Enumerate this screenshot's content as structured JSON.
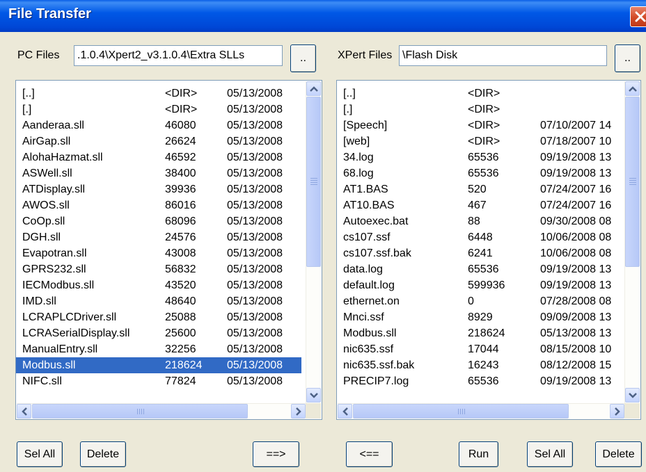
{
  "window": {
    "title": "File Transfer"
  },
  "pc": {
    "label": "PC Files",
    "path": ".1.0.4\\Xpert2_v3.1.0.4\\Extra SLLs",
    "browse_label": "..",
    "files": [
      {
        "name": "[..]",
        "size": "<DIR>",
        "date": "05/13/2008"
      },
      {
        "name": "[.]",
        "size": "<DIR>",
        "date": "05/13/2008"
      },
      {
        "name": "Aanderaa.sll",
        "size": "46080",
        "date": "05/13/2008"
      },
      {
        "name": "AirGap.sll",
        "size": "26624",
        "date": "05/13/2008"
      },
      {
        "name": "AlohaHazmat.sll",
        "size": "46592",
        "date": "05/13/2008"
      },
      {
        "name": "ASWell.sll",
        "size": "38400",
        "date": "05/13/2008"
      },
      {
        "name": "ATDisplay.sll",
        "size": "39936",
        "date": "05/13/2008"
      },
      {
        "name": "AWOS.sll",
        "size": "86016",
        "date": "05/13/2008"
      },
      {
        "name": "CoOp.sll",
        "size": "68096",
        "date": "05/13/2008"
      },
      {
        "name": "DGH.sll",
        "size": "24576",
        "date": "05/13/2008"
      },
      {
        "name": "Evapotran.sll",
        "size": "43008",
        "date": "05/13/2008"
      },
      {
        "name": "GPRS232.sll",
        "size": "56832",
        "date": "05/13/2008"
      },
      {
        "name": "IECModbus.sll",
        "size": "43520",
        "date": "05/13/2008"
      },
      {
        "name": "IMD.sll",
        "size": "48640",
        "date": "05/13/2008"
      },
      {
        "name": "LCRAPLCDriver.sll",
        "size": "25088",
        "date": "05/13/2008"
      },
      {
        "name": "LCRASerialDisplay.sll",
        "size": "25600",
        "date": "05/13/2008"
      },
      {
        "name": "ManualEntry.sll",
        "size": "32256",
        "date": "05/13/2008"
      },
      {
        "name": "Modbus.sll",
        "size": "218624",
        "date": "05/13/2008"
      },
      {
        "name": "NIFC.sll",
        "size": "77824",
        "date": "05/13/2008"
      }
    ],
    "selected_index": 17,
    "buttons": {
      "sel_all": "Sel All",
      "delete": "Delete",
      "to_xpert": "==>"
    }
  },
  "xpert": {
    "label": "XPert Files",
    "path": "\\Flash Disk",
    "browse_label": "..",
    "files": [
      {
        "name": "[..]",
        "size": "<DIR>",
        "date": ""
      },
      {
        "name": "[.]",
        "size": "<DIR>",
        "date": ""
      },
      {
        "name": "[Speech]",
        "size": "<DIR>",
        "date": "07/10/2007 14"
      },
      {
        "name": "[web]",
        "size": "<DIR>",
        "date": "07/18/2007 10"
      },
      {
        "name": "34.log",
        "size": "65536",
        "date": "09/19/2008 13"
      },
      {
        "name": "68.log",
        "size": "65536",
        "date": "09/19/2008 13"
      },
      {
        "name": "AT1.BAS",
        "size": "520",
        "date": "07/24/2007 16"
      },
      {
        "name": "AT10.BAS",
        "size": "467",
        "date": "07/24/2007 16"
      },
      {
        "name": "Autoexec.bat",
        "size": "88",
        "date": "09/30/2008 08"
      },
      {
        "name": "cs107.ssf",
        "size": "6448",
        "date": "10/06/2008 08"
      },
      {
        "name": "cs107.ssf.bak",
        "size": "6241",
        "date": "10/06/2008 08"
      },
      {
        "name": "data.log",
        "size": "65536",
        "date": "09/19/2008 13"
      },
      {
        "name": "default.log",
        "size": "599936",
        "date": "09/19/2008 13"
      },
      {
        "name": "ethernet.on",
        "size": "0",
        "date": "07/28/2008 08"
      },
      {
        "name": "Mnci.ssf",
        "size": "8929",
        "date": "09/09/2008 13"
      },
      {
        "name": "Modbus.sll",
        "size": "218624",
        "date": "05/13/2008 13"
      },
      {
        "name": "nic635.ssf",
        "size": "17044",
        "date": "08/15/2008 10"
      },
      {
        "name": "nic635.ssf.bak",
        "size": "16243",
        "date": "08/12/2008 15"
      },
      {
        "name": "PRECIP7.log",
        "size": "65536",
        "date": "09/19/2008 13"
      }
    ],
    "buttons": {
      "to_pc": "<==",
      "run": "Run",
      "sel_all": "Sel All",
      "delete": "Delete"
    }
  },
  "scroll_grip": "IIII",
  "icons": {
    "close": "close-icon",
    "up": "arrow-up-icon",
    "down": "arrow-down-icon",
    "left": "arrow-left-icon",
    "right": "arrow-right-icon"
  },
  "colors": {
    "title_bar": "#0054e3",
    "selection": "#316ac5",
    "close_button": "#d24a26",
    "scrollbar": "#c3d3fd"
  }
}
